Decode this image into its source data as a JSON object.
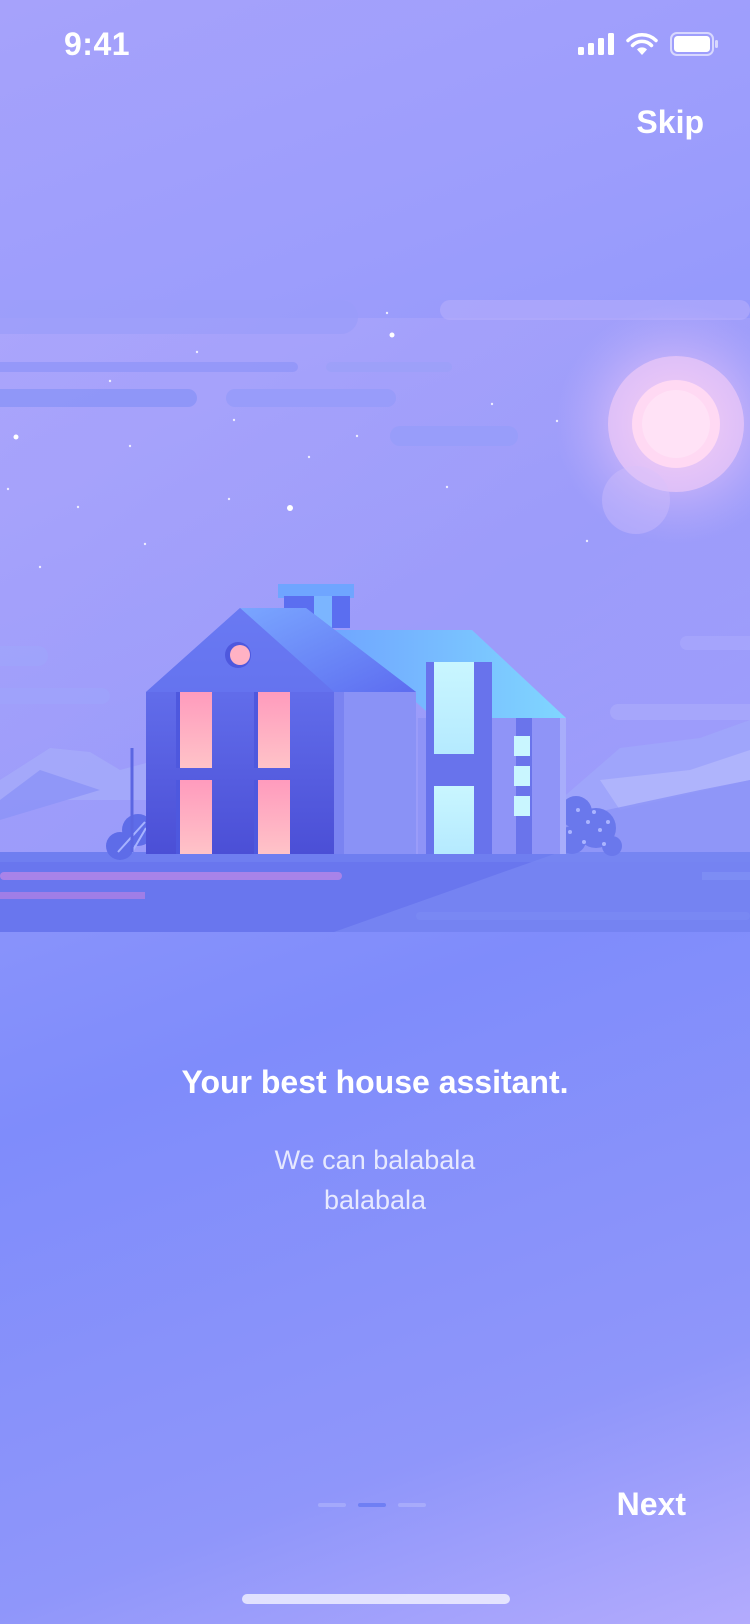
{
  "status_bar": {
    "time": "9:41",
    "signal_icon": "signal-bars-icon",
    "wifi_icon": "wifi-icon",
    "battery_icon": "battery-icon"
  },
  "header": {
    "skip_label": "Skip"
  },
  "illustration": {
    "name": "house-night-illustration",
    "colors": {
      "window_pink": "#ffaac0",
      "window_cyan": "#c3f1ff",
      "house_blue": "#5d6ef0",
      "moon": "#ffd6f2"
    }
  },
  "onboarding": {
    "title": "Your best house assitant.",
    "description": "We can balabala balabala"
  },
  "pagination": {
    "total": 3,
    "current": 2
  },
  "footer": {
    "next_label": "Next"
  }
}
